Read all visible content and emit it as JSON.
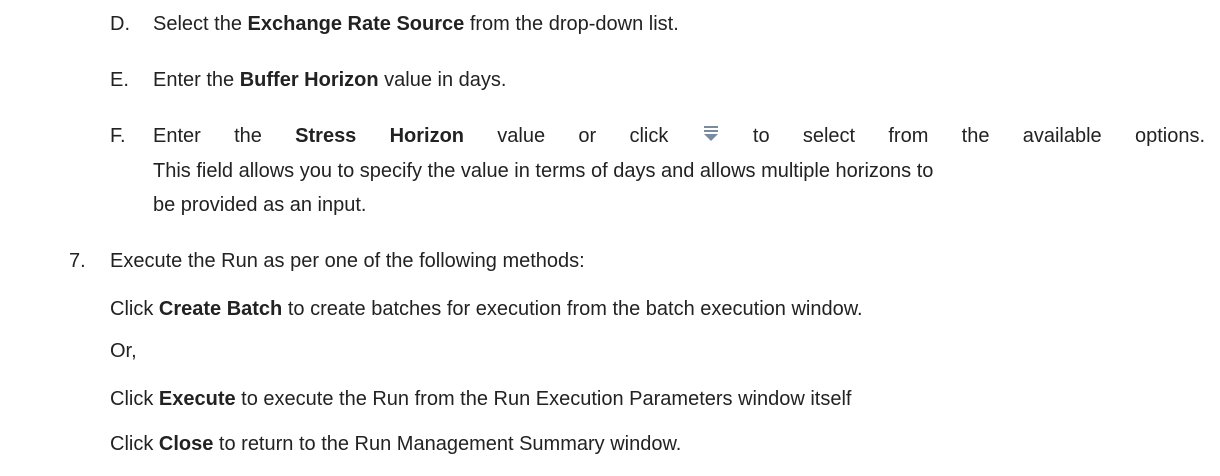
{
  "sub_steps": [
    {
      "letter": "D.",
      "pre": "Select the ",
      "bold": "Exchange Rate Source",
      "post": " from the drop-down list."
    },
    {
      "letter": "E.",
      "pre": "Enter the ",
      "bold": "Buffer Horizon",
      "post": " value in days."
    },
    {
      "letter": "F.",
      "pre": "Enter the ",
      "bold": "Stress Horizon",
      "post_a": " value or click ",
      "post_b": " to select from the available options.",
      "line2": "This field allows you to specify the value in terms of days and allows multiple horizons to",
      "line3": "be provided as an input."
    }
  ],
  "step7": {
    "number": "7.",
    "text": "Execute the Run as per one of the following methods:",
    "line_batch": {
      "pre": "Click ",
      "bold": "Create Batch",
      "post": " to create batches for execution from the batch execution window."
    },
    "or": "Or,",
    "line_execute": {
      "pre": "Click ",
      "bold": "Execute",
      "post": " to execute the Run from the Run Execution Parameters window itself"
    },
    "line_close": {
      "pre": "Click ",
      "bold": "Close",
      "post": " to return to the Run Management Summary window."
    }
  },
  "icon": {
    "name": "list-dropdown-icon",
    "color": "#7a8aa0"
  }
}
